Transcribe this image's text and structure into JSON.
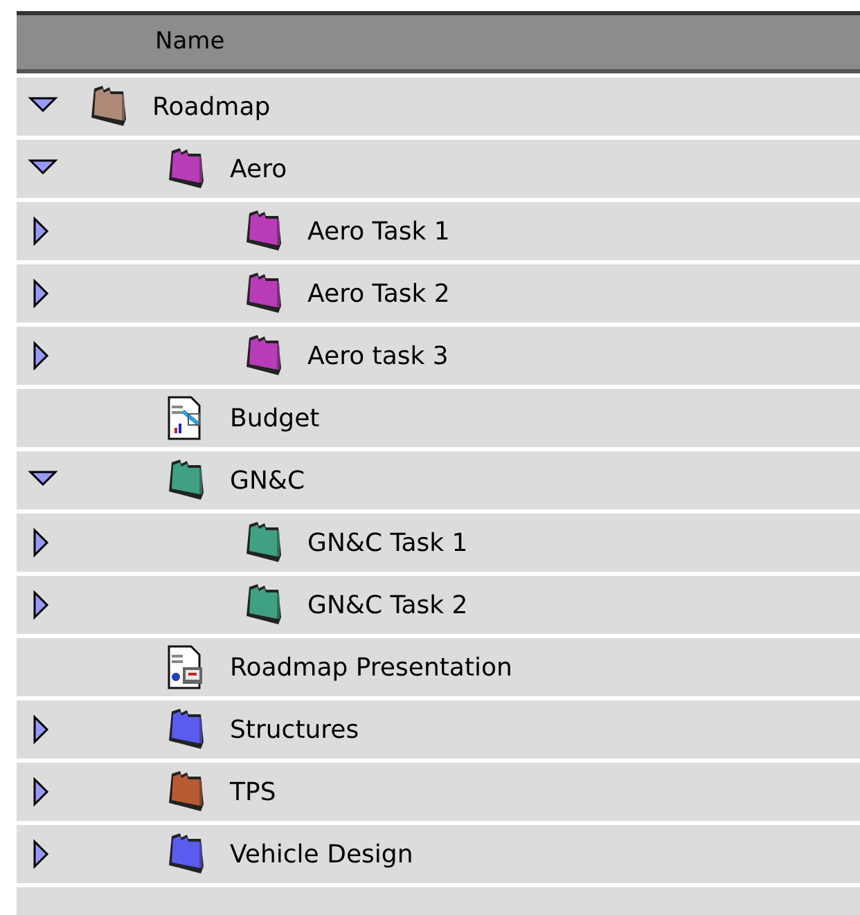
{
  "header": {
    "column": "Name"
  },
  "tree": [
    {
      "label": "Roadmap",
      "kind": "folder",
      "color": "#b08a78",
      "expanded": true,
      "children": [
        {
          "label": "Aero",
          "kind": "folder",
          "color": "#b83cb8",
          "expanded": true,
          "children": [
            {
              "label": "Aero Task 1",
              "kind": "folder",
              "color": "#b83cb8",
              "expanded": false
            },
            {
              "label": "Aero Task 2",
              "kind": "folder",
              "color": "#b83cb8",
              "expanded": false
            },
            {
              "label": "Aero task 3",
              "kind": "folder",
              "color": "#b83cb8",
              "expanded": false
            }
          ]
        },
        {
          "label": "Budget",
          "kind": "spreadsheet"
        },
        {
          "label": "GN&C",
          "kind": "folder",
          "color": "#40a084",
          "expanded": true,
          "children": [
            {
              "label": "GN&C Task 1",
              "kind": "folder",
              "color": "#40a084",
              "expanded": false
            },
            {
              "label": "GN&C Task 2",
              "kind": "folder",
              "color": "#40a084",
              "expanded": false
            }
          ]
        },
        {
          "label": "Roadmap Presentation",
          "kind": "presentation"
        },
        {
          "label": "Structures",
          "kind": "folder",
          "color": "#5a5cf0",
          "expanded": false
        },
        {
          "label": "TPS",
          "kind": "folder",
          "color": "#b85a34",
          "expanded": false
        },
        {
          "label": "Vehicle Design",
          "kind": "folder",
          "color": "#5a5cf0",
          "expanded": false
        }
      ]
    }
  ]
}
